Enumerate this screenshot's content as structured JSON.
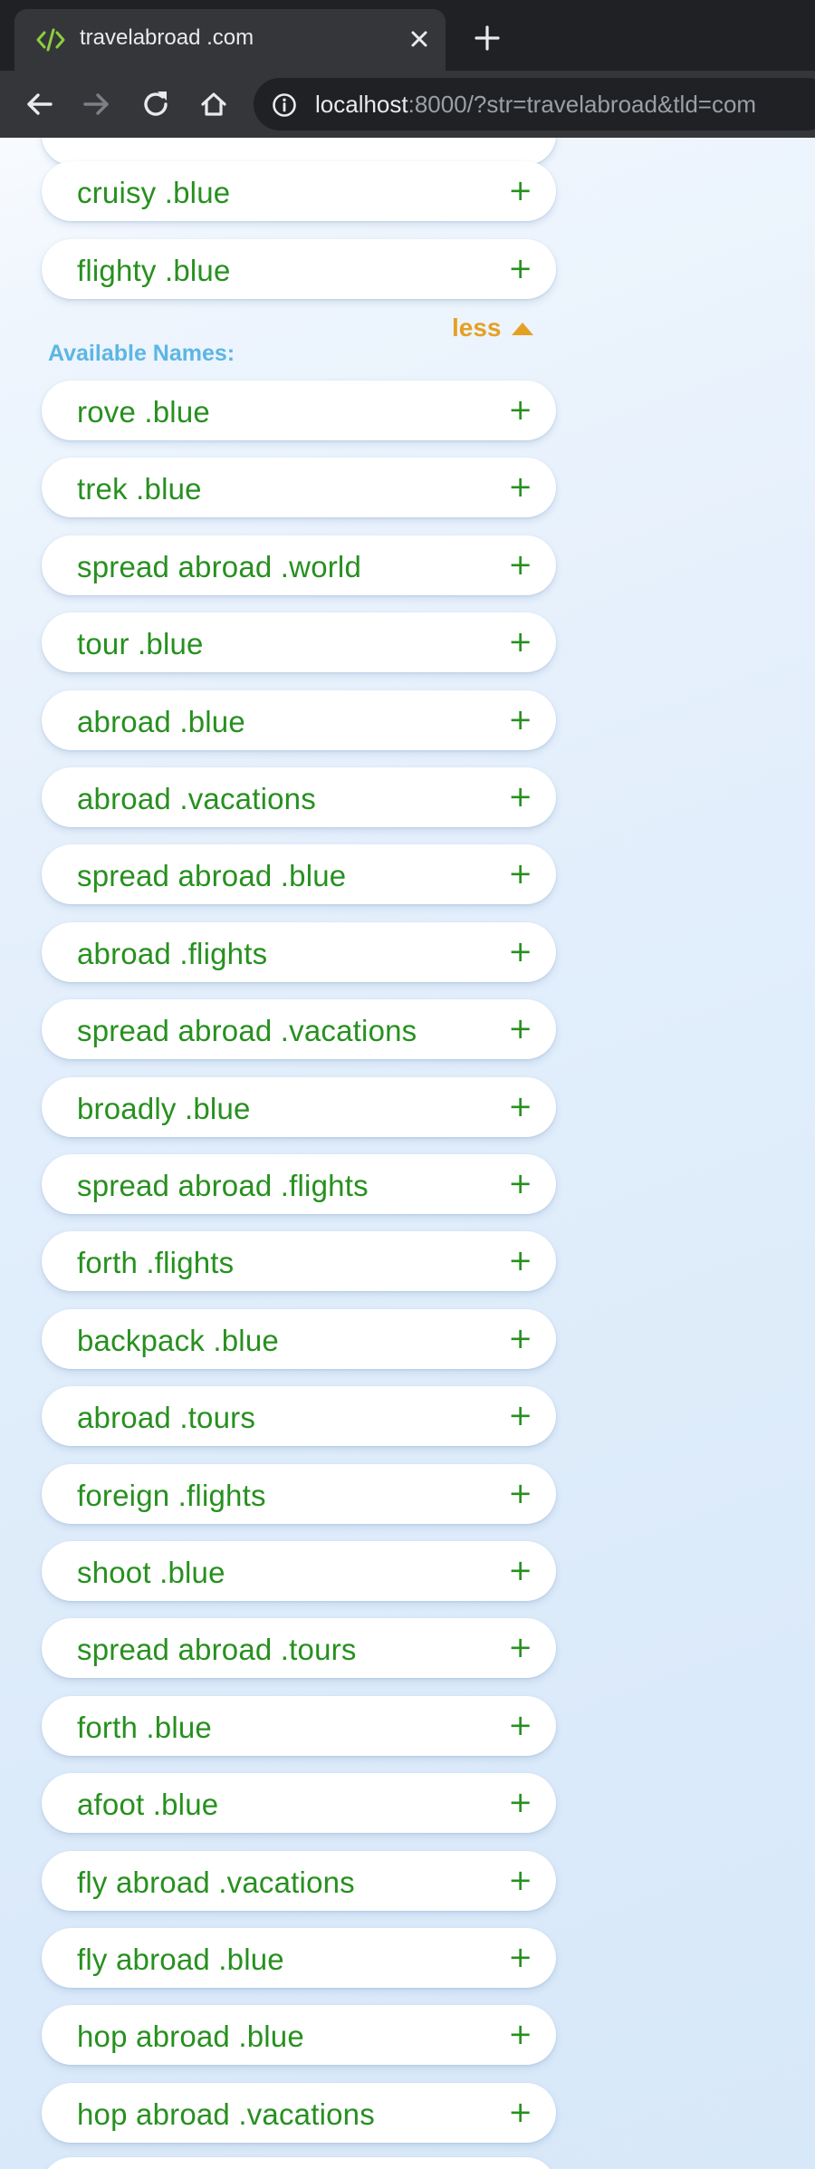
{
  "browser": {
    "tab_title": "travelabroad .com",
    "url_host": "localhost",
    "url_rest": ":8000/?str=travelabroad&tld=com",
    "icons": {
      "favicon": "code-brackets-icon",
      "close": "close-icon",
      "new_tab": "plus-icon",
      "back": "arrow-left-icon",
      "forward": "arrow-right-icon",
      "reload": "reload-icon",
      "home": "home-icon",
      "info": "info-icon"
    }
  },
  "suggested": {
    "items": [
      {
        "name": "cruisy .blue",
        "action": "+"
      },
      {
        "name": "flighty .blue",
        "action": "+"
      }
    ],
    "toggle_label": "less"
  },
  "available": {
    "heading": "Available Names:",
    "items": [
      {
        "name": "rove .blue",
        "action": "+"
      },
      {
        "name": "trek .blue",
        "action": "+"
      },
      {
        "name": "spread abroad .world",
        "action": "+"
      },
      {
        "name": "tour .blue",
        "action": "+"
      },
      {
        "name": "abroad .blue",
        "action": "+"
      },
      {
        "name": "abroad .vacations",
        "action": "+"
      },
      {
        "name": "spread abroad .blue",
        "action": "+"
      },
      {
        "name": "abroad .flights",
        "action": "+"
      },
      {
        "name": "spread abroad .vacations",
        "action": "+"
      },
      {
        "name": "broadly .blue",
        "action": "+"
      },
      {
        "name": "spread abroad .flights",
        "action": "+"
      },
      {
        "name": "forth .flights",
        "action": "+"
      },
      {
        "name": "backpack .blue",
        "action": "+"
      },
      {
        "name": "abroad .tours",
        "action": "+"
      },
      {
        "name": "foreign .flights",
        "action": "+"
      },
      {
        "name": "shoot .blue",
        "action": "+"
      },
      {
        "name": "spread abroad .tours",
        "action": "+"
      },
      {
        "name": "forth .blue",
        "action": "+"
      },
      {
        "name": "afoot .blue",
        "action": "+"
      },
      {
        "name": "fly abroad .vacations",
        "action": "+"
      },
      {
        "name": "fly abroad .blue",
        "action": "+"
      },
      {
        "name": "hop abroad .blue",
        "action": "+"
      },
      {
        "name": "hop abroad .vacations",
        "action": "+"
      }
    ]
  },
  "colors": {
    "name_green": "#27901f",
    "label_blue": "#5cb6e3",
    "toggle_orange": "#e5a024",
    "chrome_dark": "#202124",
    "chrome_mid": "#35363a"
  }
}
